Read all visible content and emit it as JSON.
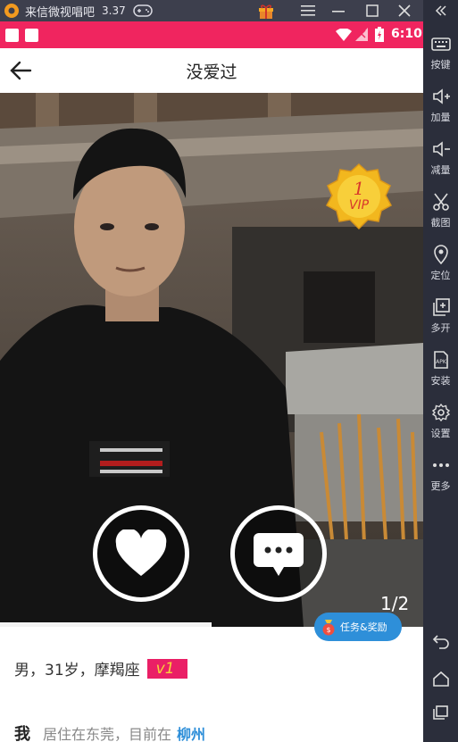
{
  "emulator": {
    "title": "来信微视唱吧",
    "version": "3.37",
    "toolbar": [
      {
        "icon": "keyboard-icon",
        "label": "按键"
      },
      {
        "icon": "volume-up-icon",
        "label": "加量"
      },
      {
        "icon": "volume-down-icon",
        "label": "减量"
      },
      {
        "icon": "scissors-icon",
        "label": "截图"
      },
      {
        "icon": "location-pin-icon",
        "label": "定位"
      },
      {
        "icon": "multi-open-icon",
        "label": "多开"
      },
      {
        "icon": "apk-install-icon",
        "label": "安装"
      },
      {
        "icon": "gear-icon",
        "label": "设置"
      },
      {
        "icon": "more-dots-icon",
        "label": "更多"
      }
    ]
  },
  "status_bar": {
    "time": "6:10",
    "color": "#f0255f"
  },
  "header": {
    "title": "没爱过"
  },
  "photo": {
    "vip_level": "1",
    "vip_text": "VIP",
    "counter": "1/2",
    "progress_fraction": 0.5
  },
  "task_button": {
    "label": "任务&奖励"
  },
  "profile": {
    "basic_info": "男，31岁，摩羯座",
    "level": "v1",
    "intro_label": "我",
    "intro_text": "居住在东莞，目前在",
    "city": "柳州"
  },
  "colors": {
    "accent_pink": "#ea1f66",
    "link_blue": "#2e8fd9",
    "vip_gold": "#f2b71e"
  }
}
